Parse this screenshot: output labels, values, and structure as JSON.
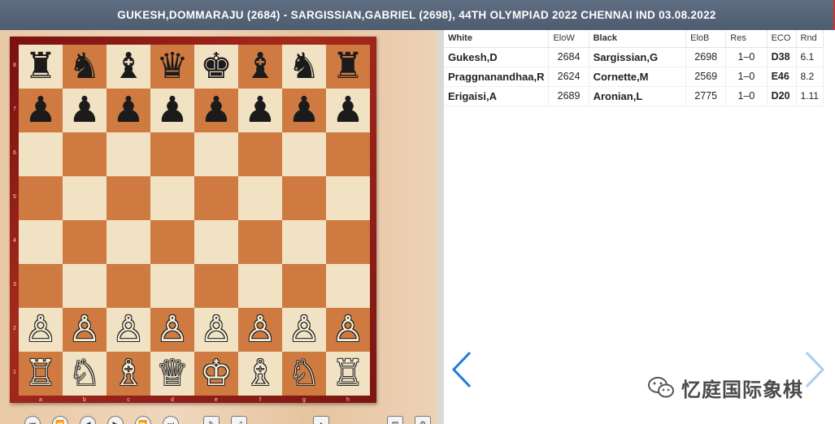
{
  "title": "GUKESH,DOMMARAJU (2684) - SARGISSIAN,GABRIEL (2698), 44TH OLYMPIAD 2022 CHENNAI IND 03.08.2022",
  "board": {
    "ranks": [
      "8",
      "7",
      "6",
      "5",
      "4",
      "3",
      "2",
      "1"
    ],
    "files": [
      "a",
      "b",
      "c",
      "d",
      "e",
      "f",
      "g",
      "h"
    ],
    "position": [
      [
        "♜",
        "♞",
        "♝",
        "♛",
        "♚",
        "♝",
        "♞",
        "♜"
      ],
      [
        "♟",
        "♟",
        "♟",
        "♟",
        "♟",
        "♟",
        "♟",
        "♟"
      ],
      [
        "",
        "",
        "",
        "",
        "",
        "",
        "",
        ""
      ],
      [
        "",
        "",
        "",
        "",
        "",
        "",
        "",
        ""
      ],
      [
        "",
        "",
        "",
        "",
        "",
        "",
        "",
        ""
      ],
      [
        "",
        "",
        "",
        "",
        "",
        "",
        "",
        ""
      ],
      [
        "♙",
        "♙",
        "♙",
        "♙",
        "♙",
        "♙",
        "♙",
        "♙"
      ],
      [
        "♖",
        "♘",
        "♗",
        "♕",
        "♔",
        "♗",
        "♘",
        "♖"
      ]
    ],
    "light_color": "#f2e2c4",
    "dark_color": "#cf7a40"
  },
  "controls": [
    "first-move-icon",
    "fast-back-icon",
    "step-back-icon",
    "step-forward-icon",
    "fast-forward-icon",
    "last-move-icon",
    "edit-icon",
    "flip-board-icon",
    "arrow-icon",
    "notation-icon",
    "settings-icon"
  ],
  "games": {
    "headers": {
      "white": "White",
      "elow": "EloW",
      "black": "Black",
      "elob": "EloB",
      "res": "Res",
      "eco": "ECO",
      "rnd": "Rnd"
    },
    "rows": [
      {
        "white": "Gukesh,D",
        "elow": "2684",
        "black": "Sargissian,G",
        "elob": "2698",
        "res": "1–0",
        "eco": "D38",
        "rnd": "6.1"
      },
      {
        "white": "Praggnanandhaa,R",
        "elow": "2624",
        "black": "Cornette,M",
        "elob": "2569",
        "res": "1–0",
        "eco": "E46",
        "rnd": "8.2"
      },
      {
        "white": "Erigaisi,A",
        "elow": "2689",
        "black": "Aronian,L",
        "elob": "2775",
        "res": "1–0",
        "eco": "D20",
        "rnd": "1.11"
      }
    ]
  },
  "nav": {
    "prev_color": "#1f7adf",
    "next_color": "#a9cdf2"
  },
  "watermark": {
    "text": "忆庭国际象棋",
    "icon": "wechat-icon"
  }
}
